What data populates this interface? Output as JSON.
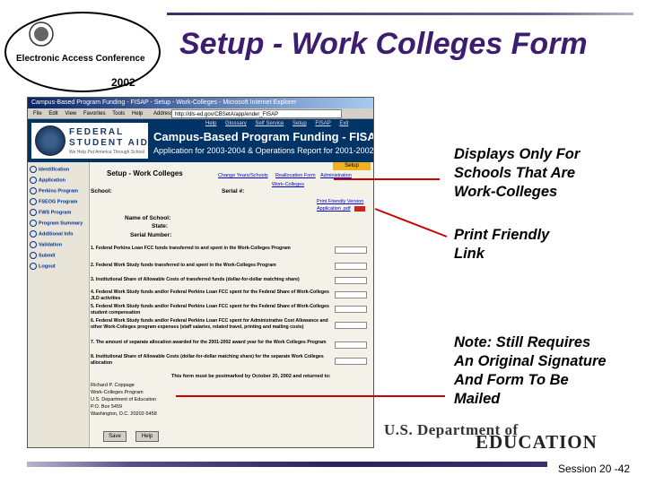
{
  "logo": {
    "line1": "Electronic Access Conference",
    "line2": "2002"
  },
  "slide_title": "Setup - Work Colleges Form",
  "browser": {
    "title": "Campus-Based Program Funding - FISAP - Setup - Work-Colleges - Microsoft Internet Explorer",
    "menu": [
      "File",
      "Edit",
      "View",
      "Favorites",
      "Tools",
      "Help"
    ],
    "address_label": "Address",
    "address": "http://dls-ed.gov/CBSetA/app/ender_FISAP"
  },
  "app": {
    "nav_links": [
      "Help",
      "Glossary",
      "Self Service",
      "Setup",
      "FISAP",
      "Exit"
    ],
    "brand_line1": "FEDERAL",
    "brand_line2": "STUDENT AID",
    "brand_tag": "We Help Put America Through School",
    "title": "Campus-Based Program Funding - FISAP",
    "subtitle": "Application for 2003-2004 & Operations Report for 2001-2002",
    "sidebar": [
      "Identification",
      "Application",
      "Perkins Program",
      "FSEOG Program",
      "FWS Program",
      "Program Summary",
      "Additional Info",
      "Validation",
      "Submit",
      "Logout"
    ],
    "active_tab": "Setup",
    "form_title": "Setup - Work Colleges",
    "top_links": [
      "Change Years/Schools",
      "Reallocation Form",
      "Administration"
    ],
    "work_colleges_link": "Work-Colleges",
    "print_link": "Print Friendly Version",
    "app_pdf": "Application .pdf",
    "school_label": "School:",
    "serial_label": "Serial #:",
    "name_label": "Name of School:",
    "state_label": "State:",
    "serial_number_label": "Serial Number:",
    "questions": [
      "1. Federal Perkins Loan FCC funds transferred to and spent in the Work-Colleges Program",
      "2. Federal Work Study funds transferred to and spent in the Work-Colleges Program",
      "3. Institutional Share of Allowable Costs of transferred funds (dollar-for-dollar matching share)",
      "4. Federal Work Study funds and/or Federal Perkins Loan FCC spent for the Federal Share of Work-Colleges JLD activities",
      "5. Federal Work Study funds and/or Federal Perkins Loan FCC spent for the Federal Share of Work-Colleges student compensation",
      "6. Federal Work Study funds and/or Federal Perkins Loan FCC spent for Administrative Cost Allowance and other Work-Colleges program expenses (staff salaries, related travel, printing and mailing costs)",
      "7. The amount of separate allocation awarded for the 2001-2002 award year for the Work Colleges Program",
      "8. Institutional Share of Allowable Costs (dollar-for-dollar matching share) for the separate Work Colleges allocation"
    ],
    "deadline": "This form must be postmarked by October 20, 2002 and returned to:",
    "address_block": [
      "Richard P. Coppage",
      "Work-Colleges Program",
      "U.S. Department of Education",
      "P.O. Box 5459",
      "Washington, D.C. 20202-5458"
    ],
    "save_label": "Save",
    "help_label": "Help"
  },
  "callouts": {
    "first": [
      "Displays Only For",
      "Schools That Are",
      "Work-Colleges"
    ],
    "second": [
      "Print Friendly",
      "Link"
    ],
    "third": [
      "Note:  Still Requires",
      "An Original Signature",
      "And Form To Be",
      "Mailed"
    ]
  },
  "ed_logo": {
    "line1": "U.S. Department of",
    "line2": "EDUCATION"
  },
  "footer": {
    "session": "Session 20 -42"
  },
  "colors": {
    "title": "#3d1d6e",
    "callout_line": "#cc0000",
    "banner": "#003366",
    "tab": "#f0b020"
  }
}
